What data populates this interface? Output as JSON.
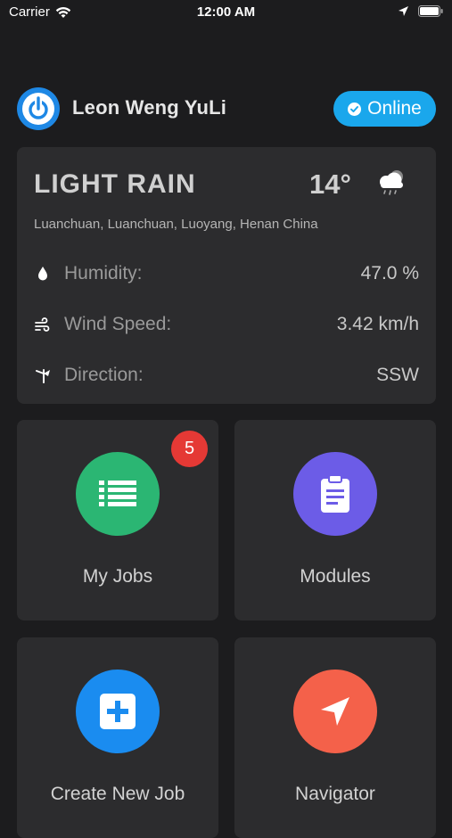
{
  "status_bar": {
    "carrier": "Carrier",
    "time": "12:00 AM"
  },
  "header": {
    "username": "Leon Weng YuLi",
    "status_label": "Online"
  },
  "weather": {
    "condition": "LIGHT RAIN",
    "temperature": "14°",
    "location": "Luanchuan, Luanchuan, Luoyang, Henan China",
    "rows": [
      {
        "icon": "droplet-icon",
        "label": "Humidity:",
        "value": "47.0 %"
      },
      {
        "icon": "wind-icon",
        "label": "Wind Speed:",
        "value": "3.42 km/h"
      },
      {
        "icon": "wind-direction-icon",
        "label": "Direction:",
        "value": "SSW"
      }
    ]
  },
  "tiles": [
    {
      "label": "My Jobs",
      "color": "#2bb673",
      "icon": "list-icon",
      "badge": "5"
    },
    {
      "label": "Modules",
      "color": "#6c5ce7",
      "icon": "clipboard-icon"
    },
    {
      "label": "Create New Job",
      "color": "#1a8cf0",
      "icon": "plus-square-icon"
    },
    {
      "label": "Navigator",
      "color": "#f4614a",
      "icon": "navigation-arrow-icon"
    }
  ],
  "colors": {
    "background": "#1c1c1e",
    "card": "#2c2c2e",
    "online": "#1aa7ec",
    "badge": "#e53935"
  }
}
